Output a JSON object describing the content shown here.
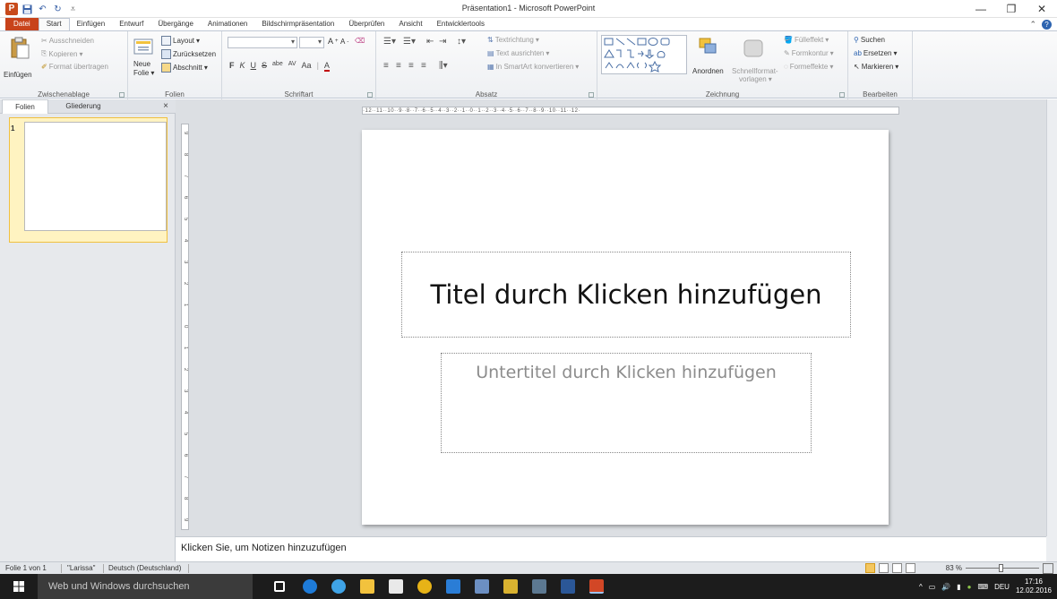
{
  "window": {
    "title": "Präsentation1 - Microsoft PowerPoint",
    "app_letter": "P",
    "minimize": "—",
    "restore": "❐",
    "close": "✕"
  },
  "tabs": [
    "Datei",
    "Start",
    "Einfügen",
    "Entwurf",
    "Übergänge",
    "Animationen",
    "Bildschirmpräsentation",
    "Überprüfen",
    "Ansicht",
    "Entwicklertools"
  ],
  "ribbon": {
    "clipboard": {
      "paste": "Einfügen",
      "cut": "Ausschneiden",
      "copy": "Kopieren",
      "format_painter": "Format übertragen",
      "label": "Zwischenablage"
    },
    "slides": {
      "new_slide_1": "Neue",
      "new_slide_2": "Folie",
      "layout": "Layout",
      "reset": "Zurücksetzen",
      "section": "Abschnitt",
      "label": "Folien"
    },
    "font": {
      "label": "Schriftart",
      "bold": "F",
      "italic": "K",
      "underline": "U",
      "strike": "S",
      "shadow": "abe",
      "spacing": "AV",
      "case": "Aa",
      "color": "A"
    },
    "paragraph": {
      "text_direction": "Textrichtung",
      "align_text": "Text ausrichten",
      "smartart": "In SmartArt konvertieren",
      "label": "Absatz"
    },
    "drawing": {
      "arrange": "Anordnen",
      "quick_styles_1": "Schnellformat-",
      "quick_styles_2": "vorlagen",
      "fill": "Fülleffekt",
      "outline": "Formkontur",
      "effects": "Formeffekte",
      "label": "Zeichnung"
    },
    "editing": {
      "find": "Suchen",
      "replace": "Ersetzen",
      "select": "Markieren",
      "label": "Bearbeiten"
    }
  },
  "left_pane": {
    "tab_slides": "Folien",
    "tab_outline": "Gliederung",
    "close": "×",
    "slide_number": "1"
  },
  "ruler": {
    "horizontal": "·12··11··10··9··8··7··6··5··4··3··2··1··0··1··2··3··4··5··6··7··8··9··10··11··12·",
    "vertical": [
      "9",
      "8",
      "7",
      "6",
      "5",
      "4",
      "3",
      "2",
      "1",
      "0",
      "1",
      "2",
      "3",
      "4",
      "5",
      "6",
      "7",
      "8",
      "9"
    ]
  },
  "slide": {
    "title_placeholder": "Titel durch Klicken hinzufügen",
    "subtitle_placeholder": "Untertitel durch Klicken hinzufügen"
  },
  "notes": {
    "placeholder": "Klicken Sie, um Notizen hinzuzufügen"
  },
  "status": {
    "slide_info": "Folie 1 von 1",
    "theme": "\"Larissa\"",
    "language": "Deutsch (Deutschland)",
    "zoom": "83 %"
  },
  "taskbar": {
    "search": "Web und Windows durchsuchen",
    "language": "DEU",
    "time": "17:16",
    "date": "12.02.2016"
  },
  "colors": {
    "file_tab": "#c8431b",
    "taskbar": "#1c1c1c",
    "selected_thumb": "#f0c040"
  }
}
